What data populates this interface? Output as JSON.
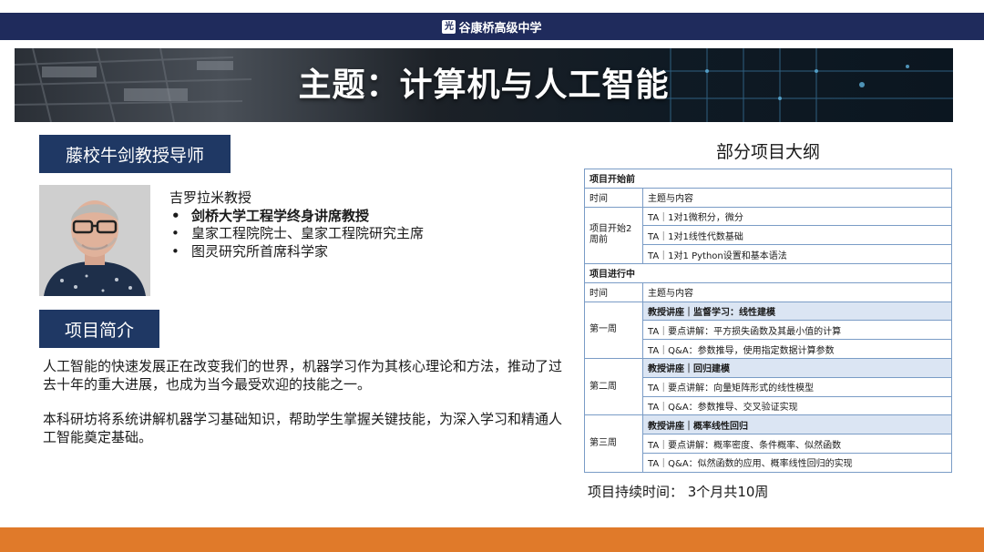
{
  "header": {
    "school_name": "谷康桥高级中学",
    "logo_mark": "光"
  },
  "banner": {
    "title": "主题：计算机与人工智能"
  },
  "mentor": {
    "label": "藤校牛剑教授导师",
    "name": "吉罗拉米教授",
    "bullets": [
      "剑桥大学工程学终身讲席教授",
      "皇家工程院院士、皇家工程院研究主席",
      "图灵研究所首席科学家"
    ]
  },
  "intro": {
    "label": "项目简介",
    "paragraphs": [
      "人工智能的快速发展正在改变我们的世界，机器学习作为其核心理论和方法，推动了过去十年的重大进展，也成为当今最受欢迎的技能之一。",
      "本科研坊将系统讲解机器学习基础知识，帮助学生掌握关键技能，为深入学习和精通人工智能奠定基础。"
    ]
  },
  "outline": {
    "title": "部分项目大纲",
    "before": {
      "section": "项目开始前",
      "col_time": "时间",
      "col_topic": "主题与内容",
      "time_label": "项目开始2周前",
      "items": [
        "TA｜1对1微积分，微分",
        "TA｜1对1线性代数基础",
        "TA｜1对1 Python设置和基本语法"
      ]
    },
    "during": {
      "section": "项目进行中",
      "col_time": "时间",
      "col_topic": "主题与内容",
      "weeks": [
        {
          "label": "第一周",
          "items": [
            "教授讲座｜监督学习：线性建模",
            "TA｜要点讲解：平方损失函数及其最小值的计算",
            "TA｜Q&A：参数推导，使用指定数据计算参数"
          ]
        },
        {
          "label": "第二周",
          "items": [
            "教授讲座｜回归建模",
            "TA｜要点讲解：向量矩阵形式的线性模型",
            "TA｜Q&A：参数推导、交叉验证实现"
          ]
        },
        {
          "label": "第三周",
          "items": [
            "教授讲座｜概率线性回归",
            "TA｜要点讲解：概率密度、条件概率、似然函数",
            "TA｜Q&A：似然函数的应用、概率线性回归的实现"
          ]
        }
      ]
    },
    "duration": "项目持续时间：  3个月共10周"
  },
  "colors": {
    "navy": "#1f2b5c",
    "label_blue": "#1f3864",
    "orange": "#e07a2a",
    "table_border": "#7a9cc6",
    "highlight": "#dbe5f3"
  }
}
